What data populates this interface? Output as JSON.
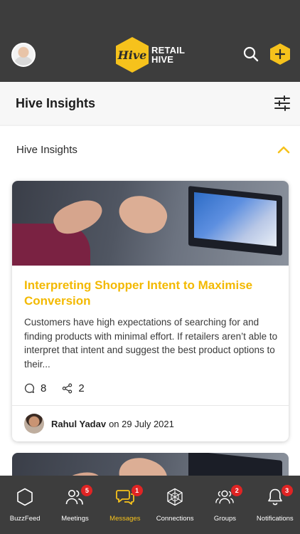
{
  "header": {
    "logo_mark": "Hive",
    "logo_line1": "RETAIL",
    "logo_line2": "HIVE",
    "icons": [
      "profile-avatar",
      "search-icon",
      "add-icon"
    ]
  },
  "title_bar": {
    "title": "Hive Insights",
    "icon": "filter-sliders-icon"
  },
  "section": {
    "title": "Hive Insights",
    "icon": "chevron-up-icon",
    "accent": "#f6c21c"
  },
  "cards": [
    {
      "title": "Interpreting Shopper Intent to Maximise Conversion",
      "excerpt": "Customers have high expectations of searching for and finding products with minimal effort. If retailers aren’t able to interpret that intent and suggest the best product options to their...",
      "comments": "8",
      "shares": "2",
      "author": "Rahul Yadav",
      "date_text": "on 29 July 2021"
    }
  ],
  "bottom_nav": [
    {
      "label": "BuzzFeed",
      "icon": "hexagon-icon",
      "badge": ""
    },
    {
      "label": "Meetings",
      "icon": "people-icon",
      "badge": "5"
    },
    {
      "label": "Messages",
      "icon": "chat-icon",
      "badge": "1",
      "active": true
    },
    {
      "label": "Connections",
      "icon": "network-icon",
      "badge": ""
    },
    {
      "label": "Groups",
      "icon": "group-icon",
      "badge": "2"
    },
    {
      "label": "Notifications",
      "icon": "bell-icon",
      "badge": "3"
    }
  ],
  "colors": {
    "header_bg": "#3d3d3d",
    "brand_yellow": "#f6c21c",
    "title_yellow": "#f3b900",
    "badge_red": "#e02424"
  }
}
